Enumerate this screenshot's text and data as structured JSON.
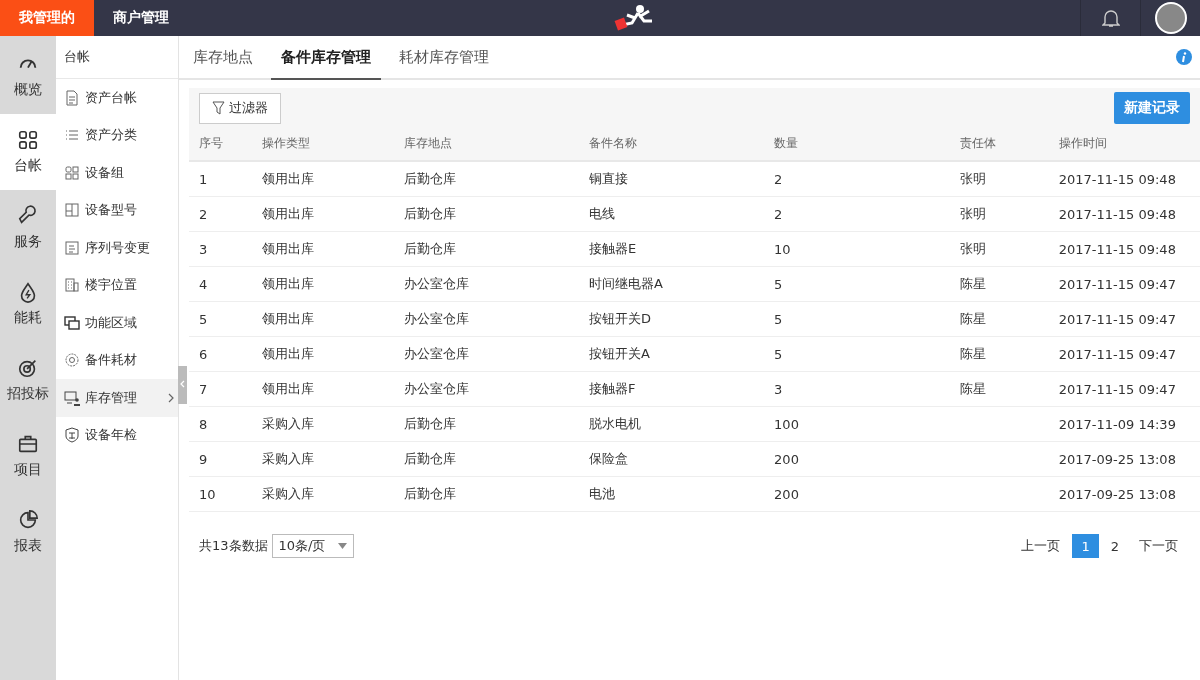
{
  "top_bar": {
    "tabs": [
      {
        "label": "我管理的",
        "selected": true
      },
      {
        "label": "商户管理",
        "selected": false
      }
    ]
  },
  "rail": [
    {
      "label": "概览",
      "selected": false
    },
    {
      "label": "台帐",
      "selected": true
    },
    {
      "label": "服务",
      "selected": false
    },
    {
      "label": "能耗",
      "selected": false
    },
    {
      "label": "招投标",
      "selected": false
    },
    {
      "label": "项目",
      "selected": false
    },
    {
      "label": "报表",
      "selected": false
    }
  ],
  "sidebar": {
    "title": "台帐",
    "items": [
      {
        "label": "资产台帐",
        "selected": false,
        "expandable": false
      },
      {
        "label": "资产分类",
        "selected": false,
        "expandable": false
      },
      {
        "label": "设备组",
        "selected": false,
        "expandable": false
      },
      {
        "label": "设备型号",
        "selected": false,
        "expandable": false
      },
      {
        "label": "序列号变更",
        "selected": false,
        "expandable": false
      },
      {
        "label": "楼宇位置",
        "selected": false,
        "expandable": false
      },
      {
        "label": "功能区域",
        "selected": false,
        "expandable": false
      },
      {
        "label": "备件耗材",
        "selected": false,
        "expandable": false
      },
      {
        "label": "库存管理",
        "selected": true,
        "expandable": true
      },
      {
        "label": "设备年检",
        "selected": false,
        "expandable": false
      }
    ]
  },
  "tabs": [
    {
      "label": "库存地点",
      "selected": false
    },
    {
      "label": "备件库存管理",
      "selected": true
    },
    {
      "label": "耗材库存管理",
      "selected": false
    }
  ],
  "toolbar": {
    "filter": "过滤器",
    "new": "新建记录"
  },
  "table": {
    "columns": [
      "序号",
      "操作类型",
      "库存地点",
      "备件名称",
      "数量",
      "责任体",
      "操作时间"
    ],
    "rows": [
      [
        "1",
        "领用出库",
        "后勤仓库",
        "铜直接",
        "2",
        "张明",
        "2017-11-15 09:48"
      ],
      [
        "2",
        "领用出库",
        "后勤仓库",
        "电线",
        "2",
        "张明",
        "2017-11-15 09:48"
      ],
      [
        "3",
        "领用出库",
        "后勤仓库",
        "接触器E",
        "10",
        "张明",
        "2017-11-15 09:48"
      ],
      [
        "4",
        "领用出库",
        "办公室仓库",
        "时间继电器A",
        "5",
        "陈星",
        "2017-11-15 09:47"
      ],
      [
        "5",
        "领用出库",
        "办公室仓库",
        "按钮开关D",
        "5",
        "陈星",
        "2017-11-15 09:47"
      ],
      [
        "6",
        "领用出库",
        "办公室仓库",
        "按钮开关A",
        "5",
        "陈星",
        "2017-11-15 09:47"
      ],
      [
        "7",
        "领用出库",
        "办公室仓库",
        "接触器F",
        "3",
        "陈星",
        "2017-11-15 09:47"
      ],
      [
        "8",
        "采购入库",
        "后勤仓库",
        "脱水电机",
        "100",
        "",
        "2017-11-09 14:39"
      ],
      [
        "9",
        "采购入库",
        "后勤仓库",
        "保险盒",
        "200",
        "",
        "2017-09-25 13:08"
      ],
      [
        "10",
        "采购入库",
        "后勤仓库",
        "电池",
        "200",
        "",
        "2017-09-25 13:08"
      ]
    ]
  },
  "pagination": {
    "total": "共13条数据",
    "page_size": "10条/页",
    "prev": "上一页",
    "pages": [
      {
        "label": "1",
        "selected": true
      },
      {
        "label": "2",
        "selected": false
      }
    ],
    "next": "下一页"
  }
}
